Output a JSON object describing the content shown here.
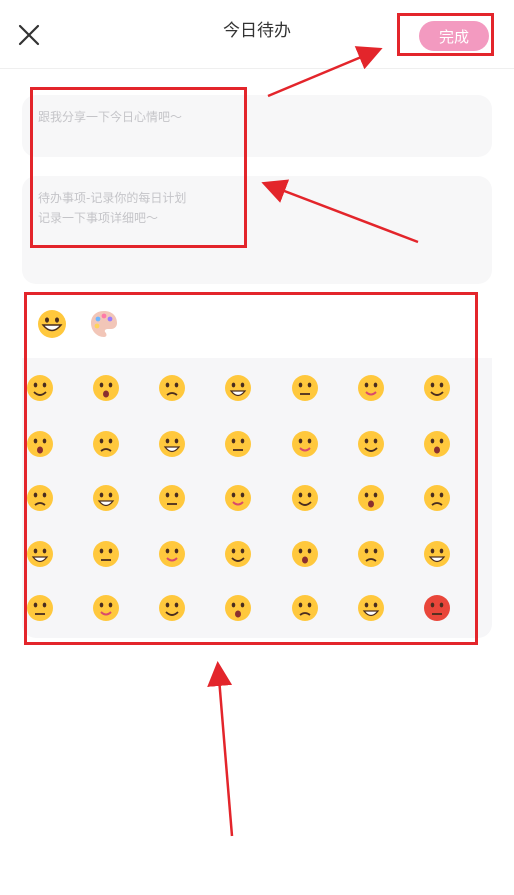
{
  "header": {
    "title": "今日待办",
    "done_label": "完成",
    "close_icon": "close-icon",
    "accent": "#f39ac0"
  },
  "fields": {
    "share_placeholder": "跟我分享一下今日心情吧～",
    "todo_placeholder_line1": "待办事项-记录你的每日计划",
    "todo_placeholder_line2": "记录一下事项详细吧～"
  },
  "emoji_picker": {
    "tabs": [
      {
        "icon": "grinning-face-icon",
        "selected": true
      },
      {
        "icon": "palette-icon",
        "selected": false
      }
    ],
    "rows": [
      [
        "face-screaming-icon",
        "angry-face-icon",
        "cold-sweat-face-icon",
        "astonished-face-icon",
        "grinning-face-icon",
        "confounded-face-icon",
        "slightly-frowning-face-icon"
      ],
      [
        "crying-face-icon",
        "pensive-face-icon",
        "disappointed-face-icon",
        "dizzy-face-icon",
        "downcast-sweat-face-icon",
        "expressionless-face-icon",
        "kissing-heart-face-icon"
      ],
      [
        "drooling-face-icon",
        "yum-face-icon",
        "fearful-face-icon",
        "mask-face-icon",
        "open-mouth-face-icon",
        "spiral-eyes-face-icon",
        "steam-nose-face-icon"
      ],
      [
        "tears-of-joy-face-icon",
        "tongue-face-icon",
        "eyes-face-icon",
        "grimacing-face-icon",
        "sweat-smile-face-icon",
        "squinting-laugh-face-icon",
        "smiling-face-icon"
      ],
      [
        "kissing-face-icon",
        "loudly-crying-face-icon",
        "sunglasses-face-icon",
        "heart-eyes-face-icon",
        "sleepy-face-icon",
        "cool-face-icon",
        "pouting-face-icon"
      ]
    ]
  },
  "annotation_color": "#e3252b"
}
